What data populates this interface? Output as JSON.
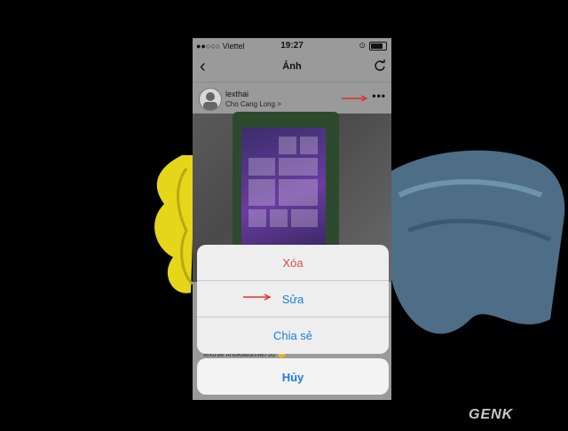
{
  "status_bar": {
    "carrier": "●●○○○ Viettel",
    "time": "19:27"
  },
  "navbar": {
    "back_icon": "chevron-left-icon",
    "title": "Ảnh",
    "refresh_icon": "refresh-icon"
  },
  "post": {
    "username": "lexthai",
    "location": "Cho Cang Long >",
    "more_icon": "•••"
  },
  "action_sheet": {
    "items": [
      {
        "label": "Xóa",
        "color": "#e0483e"
      },
      {
        "label": "Sửa",
        "color": "#1a7de0"
      },
      {
        "label": "Chia sẻ",
        "color": "#1a7de0"
      }
    ],
    "cancel_label": "Hủy"
  },
  "caption_partial": "lexthai #nokialumia730 😊",
  "watermark": "GENK",
  "colors": {
    "accent": "#1a7de0",
    "destructive": "#e0483e",
    "annotation_arrow": "#e03030"
  }
}
